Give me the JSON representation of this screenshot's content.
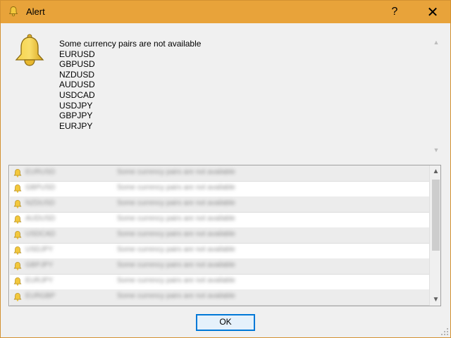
{
  "window": {
    "title": "Alert",
    "help_label": "?",
    "close_label": "✕",
    "colors": {
      "titlebar": "#e8a33a",
      "body": "#f0f0f0",
      "accent": "#0078d7"
    }
  },
  "message": {
    "heading": "Some currency pairs are not available",
    "pairs": [
      "EURUSD",
      "GBPUSD",
      "NZDUSD",
      "AUDUSD",
      "USDCAD",
      "USDJPY",
      "GBPJPY",
      "EURJPY"
    ],
    "icon": "bell-icon"
  },
  "alerts_list": {
    "icon": "bell-icon",
    "rows": [
      {
        "symbol": "EURUSD",
        "message": "Some currency pairs are not available"
      },
      {
        "symbol": "GBPUSD",
        "message": "Some currency pairs are not available"
      },
      {
        "symbol": "NZDUSD",
        "message": "Some currency pairs are not available"
      },
      {
        "symbol": "AUDUSD",
        "message": "Some currency pairs are not available"
      },
      {
        "symbol": "USDCAD",
        "message": "Some currency pairs are not available"
      },
      {
        "symbol": "USDJPY",
        "message": "Some currency pairs are not available"
      },
      {
        "symbol": "GBPJPY",
        "message": "Some currency pairs are not available"
      },
      {
        "symbol": "EURJPY",
        "message": "Some currency pairs are not available"
      },
      {
        "symbol": "EURGBP",
        "message": "Some currency pairs are not available"
      }
    ]
  },
  "buttons": {
    "ok_label": "OK"
  }
}
